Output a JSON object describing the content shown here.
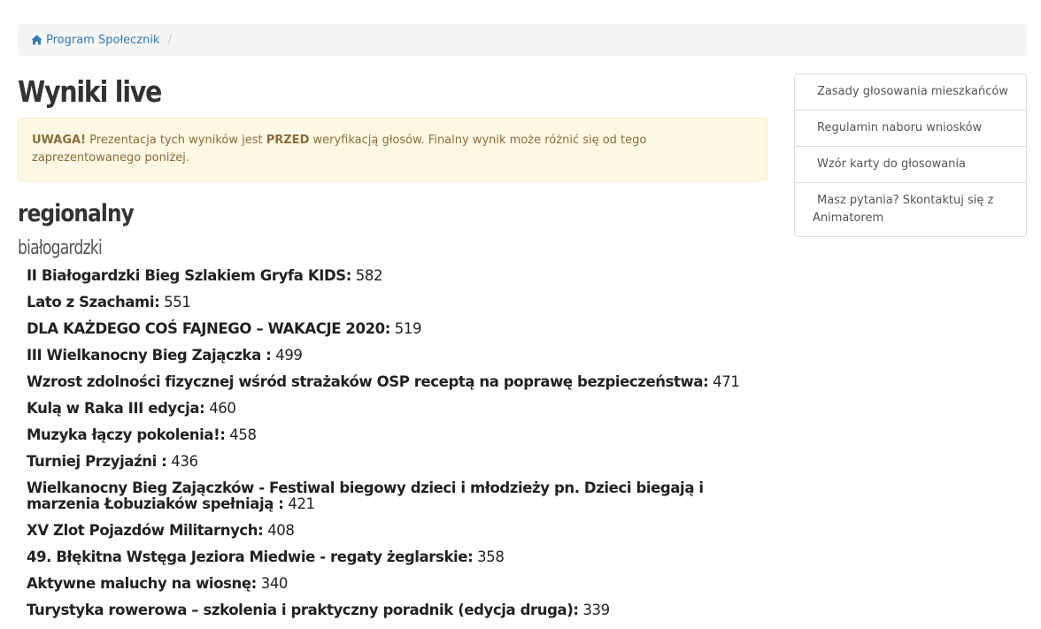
{
  "breadcrumb": {
    "items": [
      {
        "label": "Program Społecznik",
        "icon": "home-icon"
      }
    ],
    "separator": "/"
  },
  "main": {
    "title": "Wyniki live",
    "alert": {
      "prefix": "UWAGA!",
      "text_1": " Prezentacja tych wyników jest ",
      "emphasis": "PRZED",
      "text_2": " weryfikacją głosów. Finalny wynik może różnić się od tego zaprezentowanego poniżej."
    },
    "category": "regionalny",
    "subcategory": "białogardzki",
    "results": [
      {
        "name": "II Białogardzki Bieg Szlakiem Gryfa KIDS:",
        "votes": " 582"
      },
      {
        "name": "Lato z Szachami:",
        "votes": " 551"
      },
      {
        "name": "DLA KAŻDEGO COŚ FAJNEGO – WAKACJE 2020:",
        "votes": " 519"
      },
      {
        "name": "III Wielkanocny Bieg Zajączka :",
        "votes": " 499"
      },
      {
        "name": "Wzrost zdolności fizycznej wśród strażaków OSP receptą na poprawę bezpieczeństwa:",
        "votes": " 471"
      },
      {
        "name": "Kulą w Raka III edycja:",
        "votes": " 460"
      },
      {
        "name": "Muzyka łączy pokolenia!:",
        "votes": " 458"
      },
      {
        "name": "Turniej Przyjaźni :",
        "votes": " 436"
      },
      {
        "name": "Wielkanocny Bieg Zajączków - Festiwal biegowy dzieci i młodzieży pn. Dzieci biegają i marzenia Łobuziaków spełniają :",
        "votes": " 421"
      },
      {
        "name": "XV Zlot Pojazdów Militarnych:",
        "votes": " 408"
      },
      {
        "name": "49. Błękitna Wstęga Jeziora Miedwie - regaty żeglarskie:",
        "votes": " 358"
      },
      {
        "name": "Aktywne maluchy na wiosnę:",
        "votes": " 340"
      },
      {
        "name": "Turystyka rowerowa – szkolenia i praktyczny poradnik (edycja druga):",
        "votes": " 339"
      }
    ]
  },
  "sidebar": {
    "items": [
      {
        "label": "Zasady głosowania mieszkańców"
      },
      {
        "label": "Regulamin naboru wniosków"
      },
      {
        "label": "Wzór karty do głosowania"
      },
      {
        "label": "Masz pytania? Skontaktuj się z Animatorem"
      }
    ]
  },
  "colors": {
    "link": "#337ab7",
    "alert_bg": "#fcf8e3",
    "alert_border": "#faebcc",
    "alert_text": "#8a6d3b",
    "breadcrumb_bg": "#f5f5f5"
  }
}
